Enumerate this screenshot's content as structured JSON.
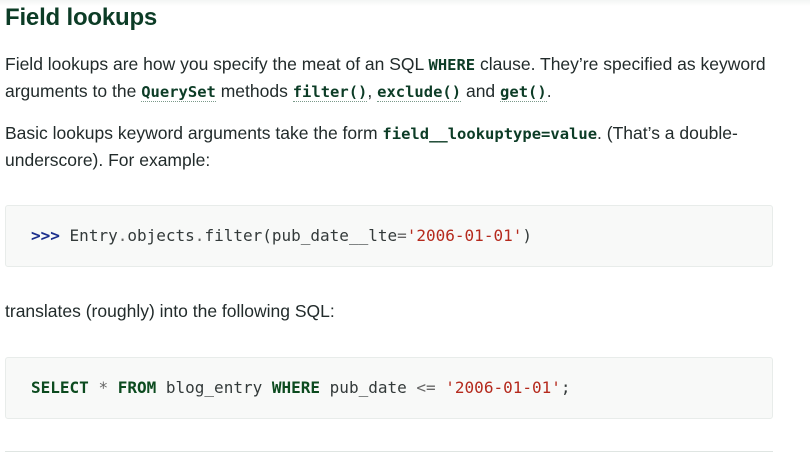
{
  "heading": "Field lookups",
  "para1": {
    "t1": "Field lookups are how you specify the meat of an SQL ",
    "c1": "WHERE",
    "t2": " clause. They’re specified as keyword arguments to the ",
    "c2": "QuerySet",
    "t3": " methods ",
    "c3": "filter()",
    "t4": ", ",
    "c4": "exclude()",
    "t5": " and ",
    "c5": "get()",
    "t6": "."
  },
  "para2": {
    "t1": "Basic lookups keyword arguments take the form ",
    "c1": "field__lookuptype=value",
    "t2": ". (That’s a double-underscore). For example:"
  },
  "code1": {
    "prompt": ">>>",
    "obj": "Entry",
    "dot1": ".",
    "attr1": "objects",
    "dot2": ".",
    "method": "filter",
    "lparen": "(",
    "kwarg": "pub_date__lte",
    "eq": "=",
    "str": "'2006-01-01'",
    "rparen": ")"
  },
  "para3": "translates (roughly) into the following SQL:",
  "code2": {
    "kw1": "SELECT",
    "star": "*",
    "kw2": "FROM",
    "table": "blog_entry",
    "kw3": "WHERE",
    "col": "pub_date",
    "op": "<=",
    "str": "'2006-01-01'",
    "semi": ";"
  }
}
